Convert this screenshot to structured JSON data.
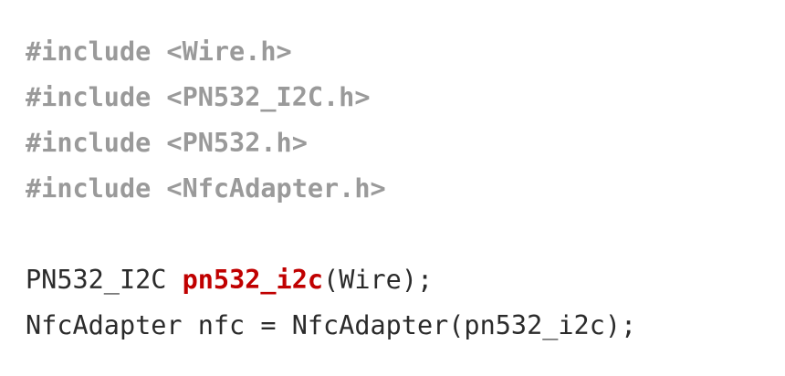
{
  "code": {
    "includes": [
      "#include <Wire.h>",
      "#include <PN532_I2C.h>",
      "#include <PN532.h>",
      "#include <NfcAdapter.h>"
    ],
    "line5": {
      "type": "PN532_I2C ",
      "name": "pn532_i2c",
      "rest": "(Wire);"
    },
    "line6": "NfcAdapter nfc = NfcAdapter(pn532_i2c);"
  },
  "colors": {
    "preprocessor": "#9a9a9a",
    "highlight": "#c00000",
    "text": "#2b2b2b",
    "background": "#ffffff"
  }
}
